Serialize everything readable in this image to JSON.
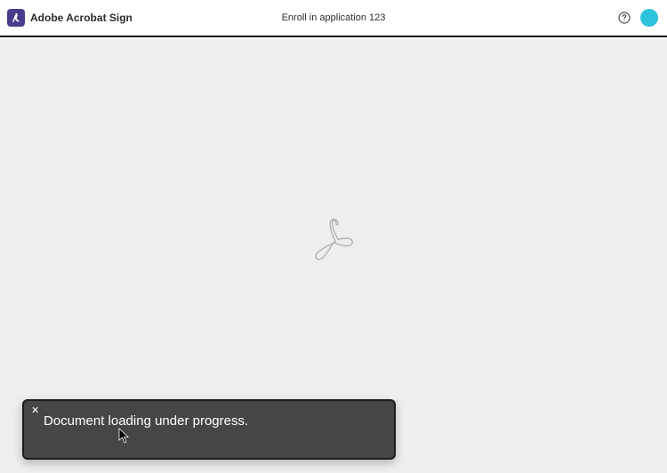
{
  "header": {
    "app_name": "Adobe Acrobat Sign",
    "doc_title": "Enroll in application 123"
  },
  "icons": {
    "app_logo": "acrobat-logo",
    "help": "help-icon",
    "avatar_color": "#2dc3dd",
    "center_mark": "acrobat-mark"
  },
  "toast": {
    "message": "Document loading under progress.",
    "close_glyph": "✕"
  }
}
